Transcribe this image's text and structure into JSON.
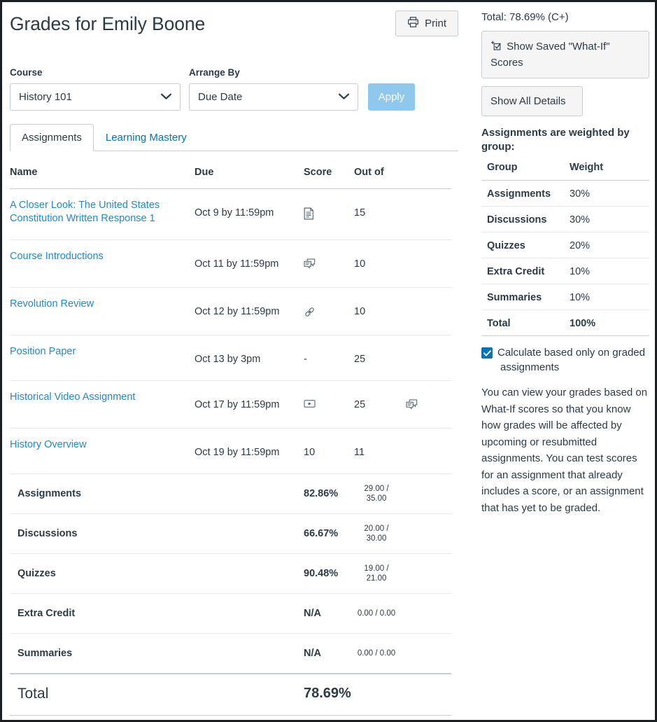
{
  "header": {
    "title": "Grades for Emily Boone",
    "print_label": "Print"
  },
  "filters": {
    "course_label": "Course",
    "course_value": "History 101",
    "arrange_label": "Arrange By",
    "arrange_value": "Due Date",
    "apply_label": "Apply"
  },
  "tabs": [
    {
      "label": "Assignments",
      "active": true
    },
    {
      "label": "Learning Mastery",
      "active": false
    }
  ],
  "grades_table": {
    "columns": [
      "Name",
      "Due",
      "Score",
      "Out of",
      ""
    ],
    "assignments": [
      {
        "name": "A Closer Look: The United States Constitution Written Response 1",
        "due": "Oct 9 by 11:59pm",
        "score_icon": "document-icon",
        "score": "",
        "out_of": "15",
        "comment_icon": ""
      },
      {
        "name": "Course Introductions",
        "due": "Oct 11 by 11:59pm",
        "score_icon": "discussion-icon",
        "score": "",
        "out_of": "10",
        "comment_icon": ""
      },
      {
        "name": "Revolution Review",
        "due": "Oct 12 by 11:59pm",
        "score_icon": "link-icon",
        "score": "",
        "out_of": "10",
        "comment_icon": ""
      },
      {
        "name": "Position Paper",
        "due": "Oct 13 by 3pm",
        "score_icon": "",
        "score": "-",
        "out_of": "25",
        "comment_icon": ""
      },
      {
        "name": "Historical Video Assignment",
        "due": "Oct 17 by 11:59pm",
        "score_icon": "media-play-icon",
        "score": "",
        "out_of": "25",
        "comment_icon": "comment-icon"
      },
      {
        "name": "History Overview",
        "due": "Oct 19 by 11:59pm",
        "score_icon": "",
        "score": "10",
        "out_of": "11",
        "comment_icon": ""
      }
    ],
    "groups": [
      {
        "name": "Assignments",
        "percent": "82.86%",
        "points": "29.00 / 35.00"
      },
      {
        "name": "Discussions",
        "percent": "66.67%",
        "points": "20.00 / 30.00"
      },
      {
        "name": "Quizzes",
        "percent": "90.48%",
        "points": "19.00 / 21.00"
      },
      {
        "name": "Extra Credit",
        "percent": "N/A",
        "points": "0.00 / 0.00"
      },
      {
        "name": "Summaries",
        "percent": "N/A",
        "points": "0.00 / 0.00"
      }
    ],
    "total": {
      "label": "Total",
      "percent": "78.69%"
    }
  },
  "sidebar": {
    "total_line": "Total: 78.69% (C+)",
    "show_whatif_label": "Show Saved \"What-If\" Scores",
    "show_all_details_label": "Show All Details",
    "weights_heading": "Assignments are weighted by group:",
    "weights_table": {
      "col_group": "Group",
      "col_weight": "Weight",
      "rows": [
        {
          "group": "Assignments",
          "weight": "30%"
        },
        {
          "group": "Discussions",
          "weight": "30%"
        },
        {
          "group": "Quizzes",
          "weight": "20%"
        },
        {
          "group": "Extra Credit",
          "weight": "10%"
        },
        {
          "group": "Summaries",
          "weight": "10%"
        }
      ],
      "total_group": "Total",
      "total_weight": "100%"
    },
    "calculate_label": "Calculate based only on graded assignments",
    "calculate_checked": true,
    "description": "You can view your grades based on What-If scores so that you know how grades will be affected by upcoming or resubmitted assignments. You can test scores for an assignment that already includes a score, or an assignment that has yet to be graded."
  },
  "colors": {
    "link": "#2389ce",
    "tab_link": "#0374b5",
    "text": "#2d3b45",
    "apply_button": "#8fc7ed",
    "checkbox": "#0374b5",
    "border": "#c7cdd1",
    "row_border": "#e8eaec"
  }
}
